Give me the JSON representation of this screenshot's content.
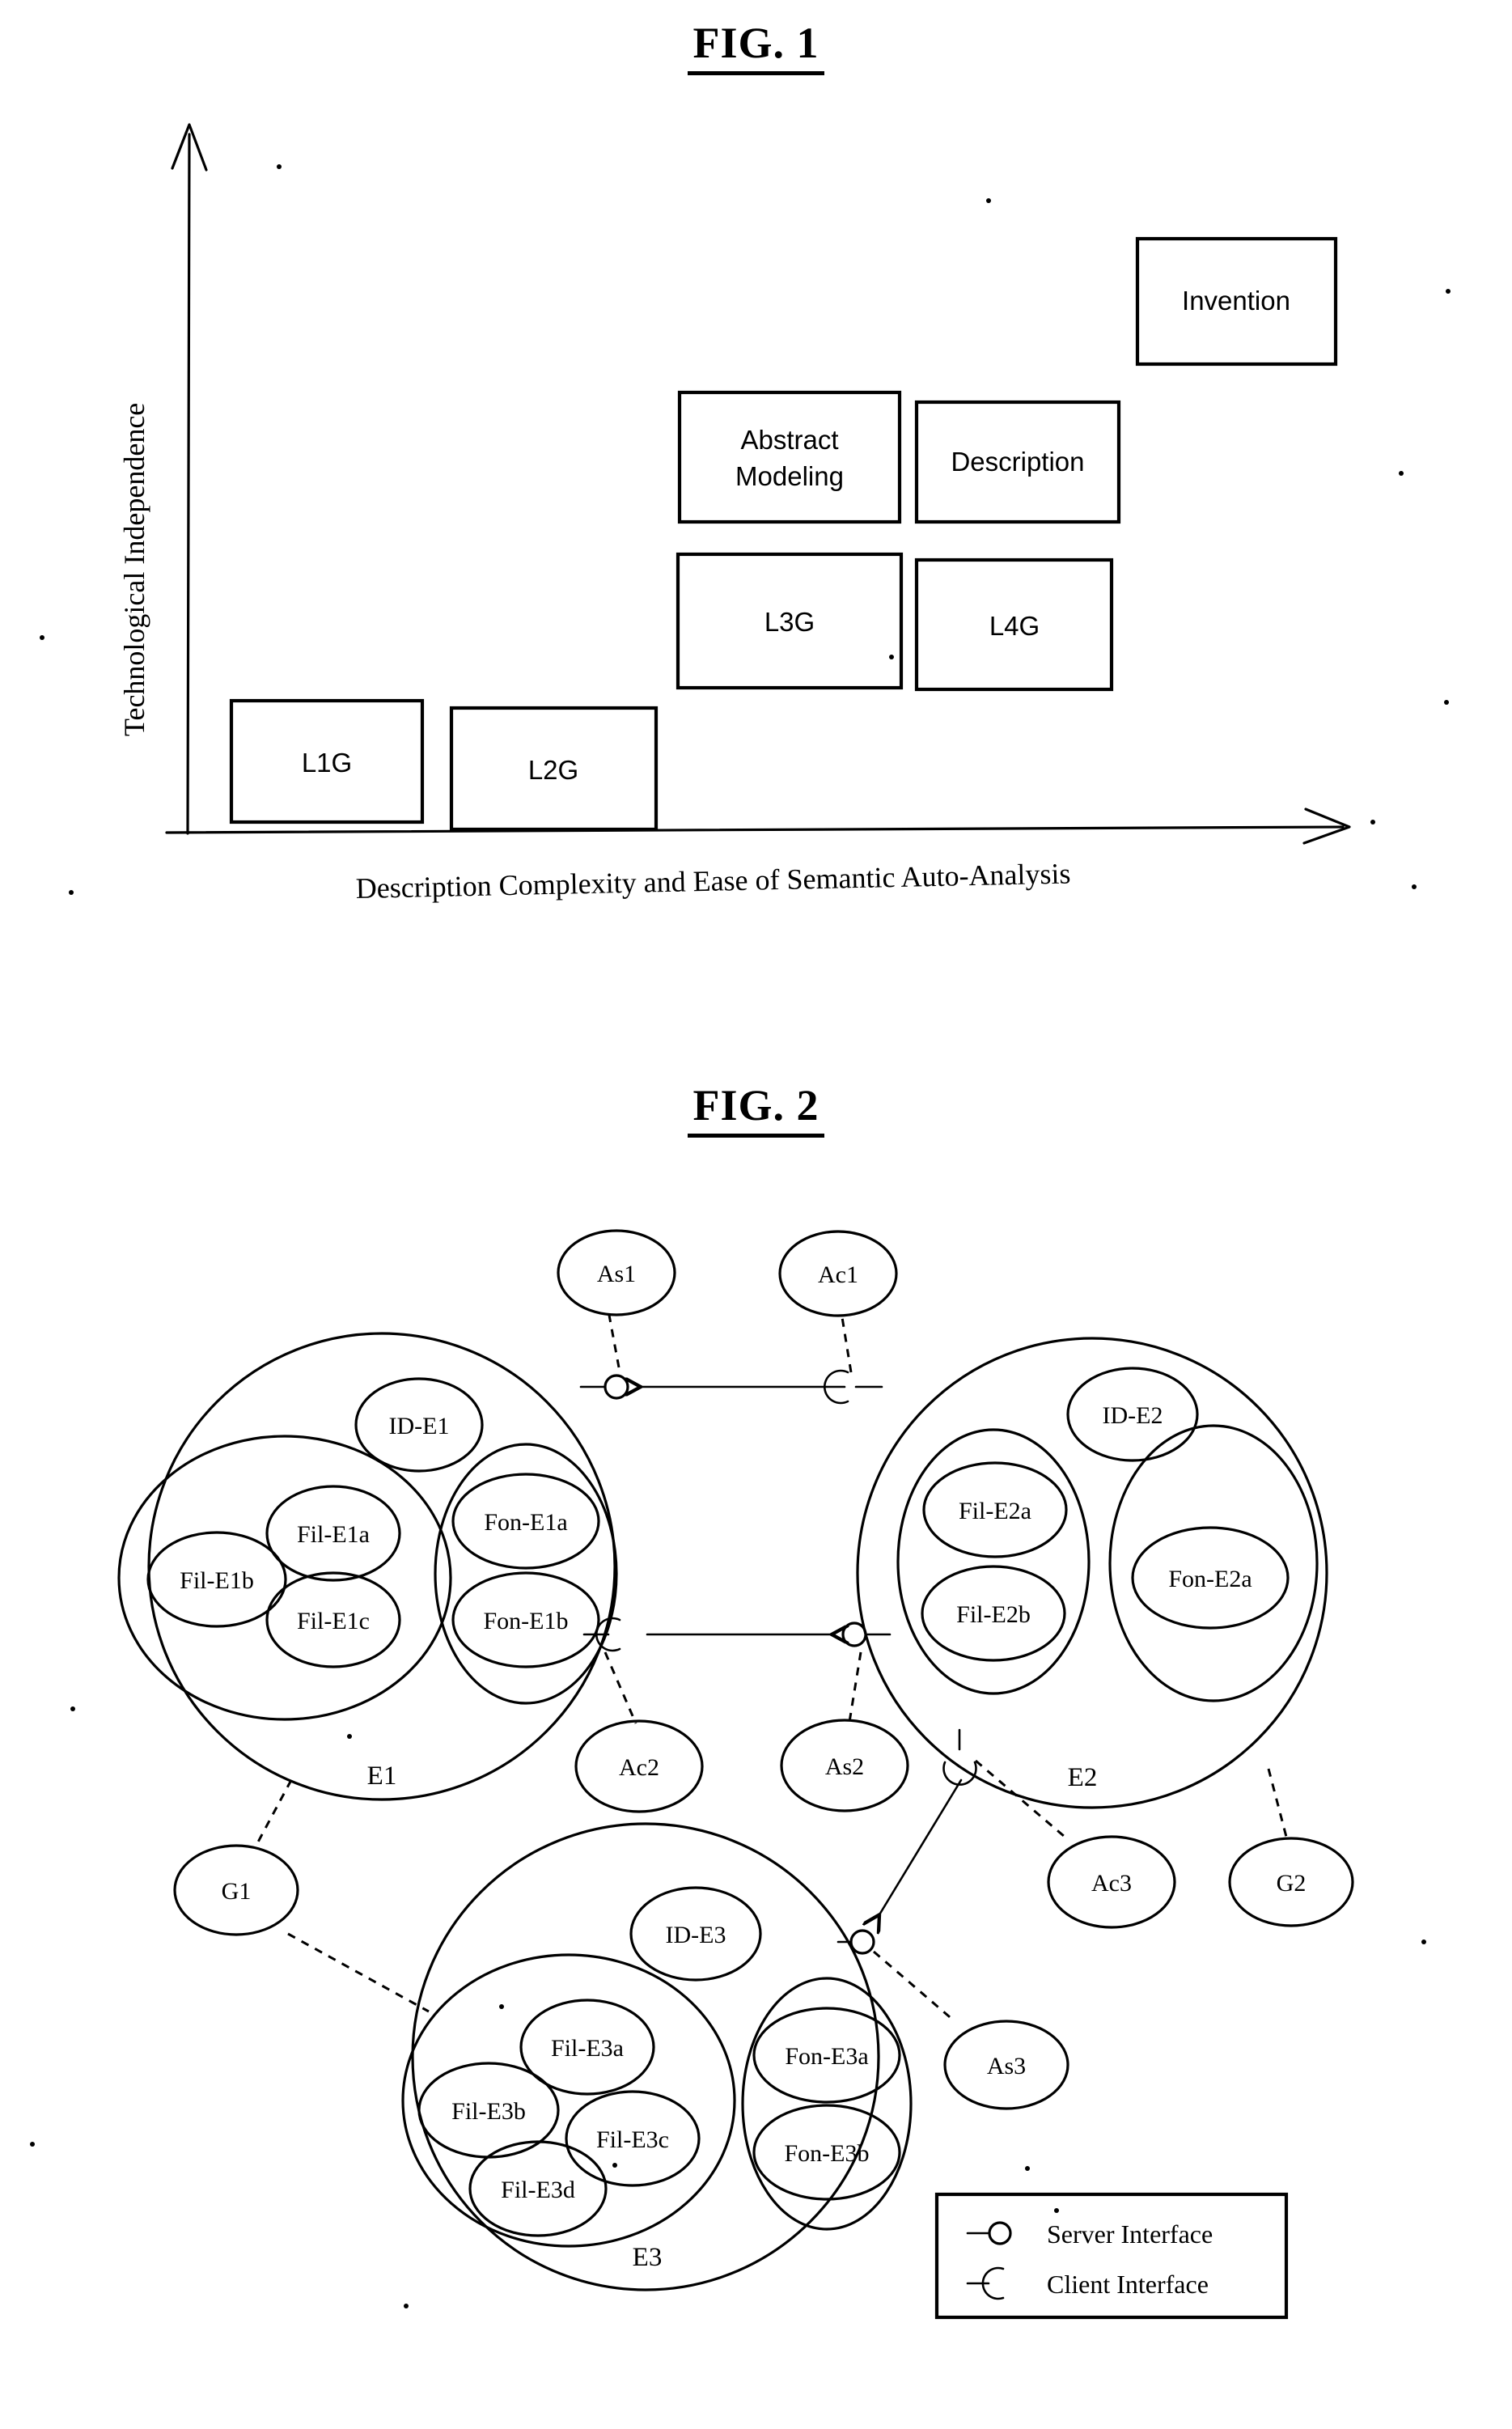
{
  "figures": {
    "fig1": {
      "title": "FIG. 1",
      "y_axis_label": "Technological Independence",
      "x_axis_label": "Description Complexity and Ease of Semantic Auto-Analysis",
      "boxes": [
        {
          "id": "l1g",
          "label": "L1G"
        },
        {
          "id": "l2g",
          "label": "L2G"
        },
        {
          "id": "l3g",
          "label": "L3G"
        },
        {
          "id": "l4g",
          "label": "L4G"
        },
        {
          "id": "abstract-modeling",
          "label": "Abstract\nModeling",
          "line1": "Abstract",
          "line2": "Modeling"
        },
        {
          "id": "description",
          "label": "Description"
        },
        {
          "id": "invention",
          "label": "Invention"
        }
      ]
    },
    "fig2": {
      "title": "FIG. 2",
      "entities": [
        {
          "id": "e1",
          "label": "E1",
          "identity": "ID-E1",
          "fil_group": [
            "Fil-E1a",
            "Fil-E1b",
            "Fil-E1c"
          ],
          "fon_group": [
            "Fon-E1a",
            "Fon-E1b"
          ]
        },
        {
          "id": "e2",
          "label": "E2",
          "identity": "ID-E2",
          "fil_group": [
            "Fil-E2a",
            "Fil-E2b"
          ],
          "fon_group": [
            "Fon-E2a"
          ]
        },
        {
          "id": "e3",
          "label": "E3",
          "identity": "ID-E3",
          "fil_group": [
            "Fil-E3a",
            "Fil-E3b",
            "Fil-E3c",
            "Fil-E3d"
          ],
          "fon_group": [
            "Fon-E3a",
            "Fon-E3b"
          ]
        }
      ],
      "annotations": [
        {
          "id": "as1",
          "label": "As1",
          "kind": "server-interface",
          "attached_to": "e1"
        },
        {
          "id": "ac1",
          "label": "Ac1",
          "kind": "client-interface",
          "attached_to": "e2"
        },
        {
          "id": "ac2",
          "label": "Ac2",
          "kind": "client-interface",
          "attached_to": "e1"
        },
        {
          "id": "as2",
          "label": "As2",
          "kind": "server-interface",
          "attached_to": "e2"
        },
        {
          "id": "ac3",
          "label": "Ac3",
          "kind": "client-interface",
          "attached_to": "e2"
        },
        {
          "id": "as3",
          "label": "As3",
          "kind": "server-interface",
          "attached_to": "e3"
        },
        {
          "id": "g1",
          "label": "G1",
          "kind": "group",
          "attached_to": "e1,e3"
        },
        {
          "id": "g2",
          "label": "G2",
          "kind": "group",
          "attached_to": "e2"
        }
      ],
      "legend": {
        "items": [
          {
            "id": "server-interface",
            "label": "Server Interface",
            "symbol": "lollipop-circle"
          },
          {
            "id": "client-interface",
            "label": "Client Interface",
            "symbol": "socket-half-circle"
          }
        ]
      }
    }
  },
  "colors": {
    "ink": "#000000",
    "paper": "#ffffff"
  }
}
